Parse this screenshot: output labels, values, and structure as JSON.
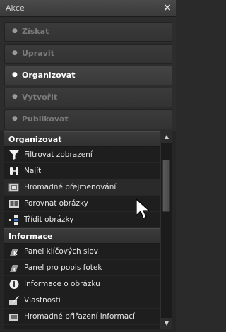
{
  "window": {
    "title": "Akce",
    "close_glyph": "×"
  },
  "categories": [
    {
      "label": "Získat",
      "active": false
    },
    {
      "label": "Upravit",
      "active": false
    },
    {
      "label": "Organizovat",
      "active": true
    },
    {
      "label": "Vytvořit",
      "active": false
    },
    {
      "label": "Publikovat",
      "active": false
    }
  ],
  "sections": [
    {
      "title": "Organizovat",
      "items": [
        {
          "label": "Filtrovat zobrazení",
          "icon": "filter-icon"
        },
        {
          "label": "Najít",
          "icon": "binoculars-icon"
        },
        {
          "label": "Hromadné přejmenování",
          "icon": "batch-rename-icon"
        },
        {
          "label": "Porovnat obrázky",
          "icon": "compare-images-icon"
        },
        {
          "label": "Třídit obrázky",
          "icon": "sort-images-icon"
        }
      ]
    },
    {
      "title": "Informace",
      "items": [
        {
          "label": "Panel klíčových slov",
          "icon": "keywords-icon"
        },
        {
          "label": "Panel pro popis fotek",
          "icon": "photo-caption-icon"
        },
        {
          "label": "Informace o obrázku",
          "icon": "info-icon"
        },
        {
          "label": "Vlastnosti",
          "icon": "properties-icon"
        },
        {
          "label": "Hromadné přiřazení informací",
          "icon": "batch-assign-icon"
        }
      ]
    }
  ],
  "scrollbar": {
    "up": "▲",
    "down": "▼"
  }
}
